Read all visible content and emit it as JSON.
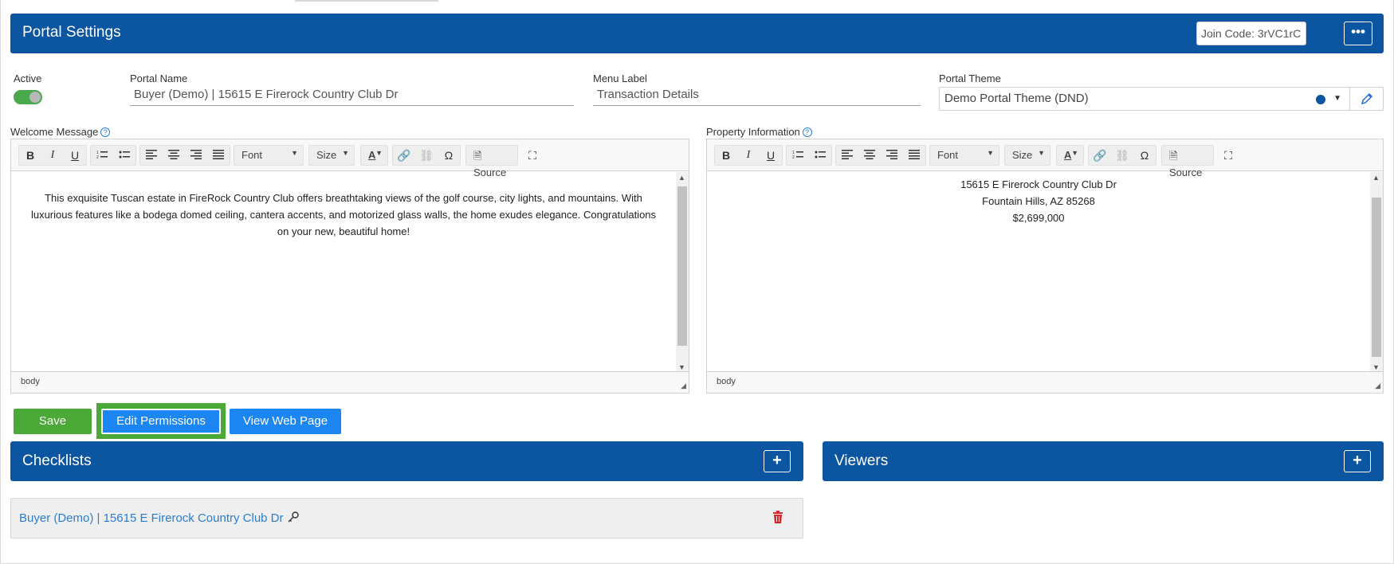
{
  "header": {
    "title": "Portal Settings",
    "join_code": "Join Code: 3rVC1rC",
    "more_label": "•••"
  },
  "fields": {
    "active_label": "Active",
    "portal_name_label": "Portal Name",
    "portal_name_value": "Buyer (Demo) | 15615 E Firerock Country Club Dr",
    "menu_label_label": "Menu Label",
    "menu_label_value": "Transaction Details",
    "portal_theme_label": "Portal Theme",
    "portal_theme_value": "Demo Portal Theme (DND)",
    "active": true
  },
  "toolbar": {
    "bold": "B",
    "italic": "I",
    "underline": "U",
    "font": "Font",
    "size": "Size",
    "text_color": "A",
    "special_char": "Ω",
    "source": "Source"
  },
  "welcome": {
    "label": "Welcome Message",
    "text": "This exquisite Tuscan estate in FireRock Country Club offers breathtaking views of the golf course, city lights, and mountains. With luxurious features like a bodega domed ceiling, cantera accents, and motorized glass walls, the home exudes elegance. Congratulations on your new, beautiful home!",
    "status": "body"
  },
  "property": {
    "label": "Property Information",
    "line1": "15615 E Firerock Country Club Dr",
    "line2": "Fountain Hills, AZ 85268",
    "line3": "$2,699,000",
    "status": "body"
  },
  "actions": {
    "save": "Save",
    "edit_permissions": "Edit Permissions",
    "view_web_page": "View Web Page"
  },
  "checklists": {
    "title": "Checklists",
    "add": "+",
    "items": [
      {
        "label": "Buyer (Demo) | 15615 E Firerock Country Club Dr"
      }
    ]
  },
  "viewers": {
    "title": "Viewers",
    "add": "+"
  },
  "colors": {
    "brand": "#0c55a0",
    "save": "#4aa937",
    "primary": "#1c86f2",
    "delete": "#d9262c"
  }
}
